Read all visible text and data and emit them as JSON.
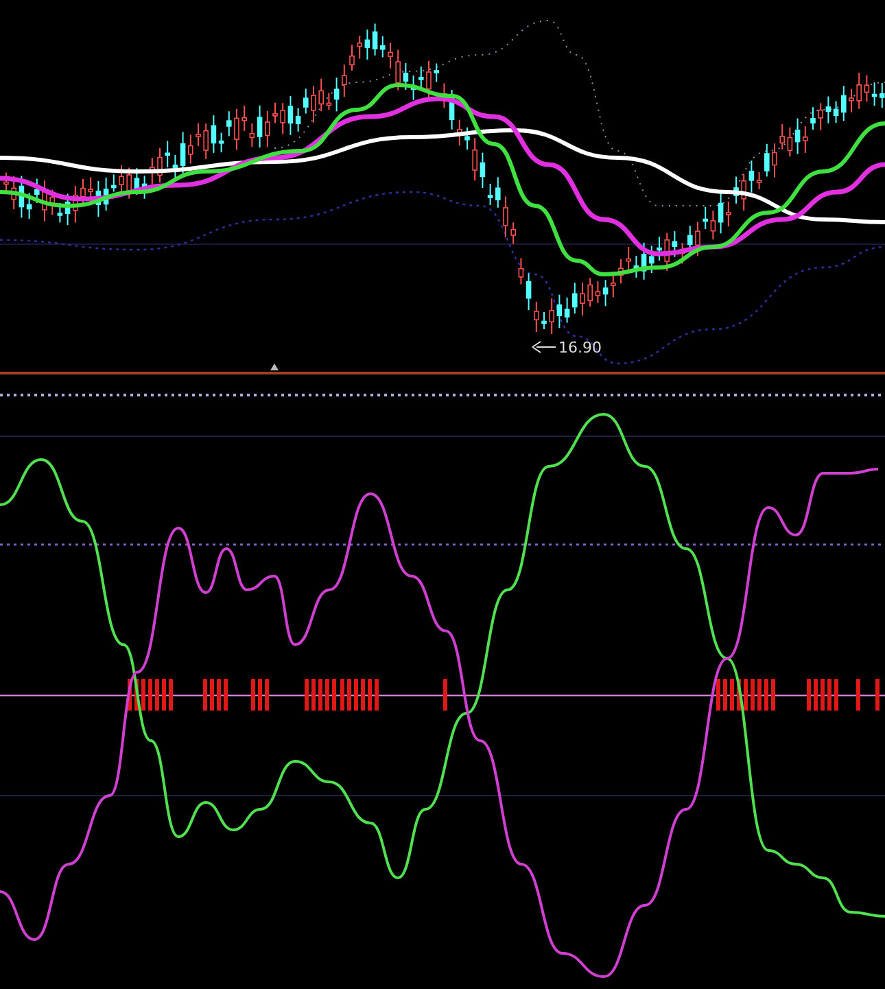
{
  "price_chart": {
    "low_label": "16.90"
  }
}
